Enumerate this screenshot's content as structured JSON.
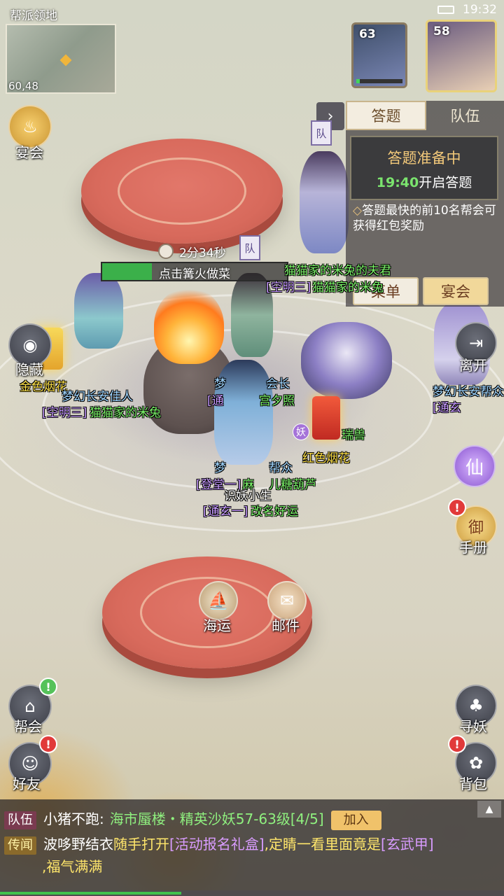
{
  "status_bar": {
    "time": "19:32"
  },
  "minimap": {
    "title": "帮派领地",
    "coords": "60,48"
  },
  "portraits": {
    "pet_level": "63",
    "pet_hp_fraction": 0.08,
    "hero_level": "58"
  },
  "quest_panel": {
    "tabs": [
      {
        "label": "答题",
        "active": true
      },
      {
        "label": "队伍",
        "active": false
      }
    ],
    "status_title": "答题准备中",
    "start_time": "19:40",
    "start_suffix": "开启答题",
    "description": "答题最快的前10名帮会可获得红包奖励",
    "menu_button": "菜单",
    "banquet_button": "宴会"
  },
  "left_icons": {
    "banquet": "宴会",
    "hide": "隐藏",
    "guild": "帮会",
    "friends": "好友"
  },
  "right_icons": {
    "leave": "离开",
    "immortal": "仙",
    "handbook": "手册",
    "handbook_badge_text": "御",
    "find_demon": "寻妖",
    "backpack": "背包"
  },
  "badges": {
    "alert": "!"
  },
  "center_icons": {
    "shipping": "海运",
    "mail": "邮件"
  },
  "cooking": {
    "timer": "2分34秒",
    "action": "点击篝火做菜",
    "progress": 0.27
  },
  "team_flag": "队",
  "yao_badge": "妖",
  "name_tags": {
    "husband_name": "猫猫家的米兔的夫君",
    "rank1": "[空明三]",
    "guild1": "猫猫家的米兔",
    "fireworks_gold": "金色烟花",
    "player_a_title": "梦幻长安佳人",
    "player_a_rank": "[空明三]",
    "player_a_name": "猫猫家的米兔",
    "center_title": "梦",
    "center_title_suffix": "会长",
    "center_rank": "[通",
    "center_name": "宫夕照",
    "pet_name": "瑞兽",
    "fireworks_red": "红色烟花",
    "player_c_title": "梦",
    "player_c_title_suffix": "帮众",
    "player_c_rank": "[登堂一]",
    "player_c_name": "麻",
    "player_c_name_suffix": "儿糖葫芦",
    "player_d_title": "识妖小生",
    "player_d_rank": "[通玄一]",
    "player_d_name": "改名好运",
    "right_title": "梦幻长安帮众",
    "right_rank": "[通玄"
  },
  "chat": {
    "team": {
      "channel": "队伍",
      "sender": "小猪不跑:",
      "message": "海市蜃楼・精英沙妖57-63级[4/5]",
      "join": "加入"
    },
    "rumor": {
      "channel": "传闻",
      "sender": "波哆野结衣",
      "text1": "随手打开",
      "item1": "[活动报名礼盒]",
      "text2": ",定睛一看里面竟是",
      "item2": "[玄武甲]",
      "text3": ",福气满满"
    }
  },
  "colors": {
    "accent": "#f3c97a",
    "highlight_green": "#7be46e",
    "alert_red": "#e13a3a"
  }
}
